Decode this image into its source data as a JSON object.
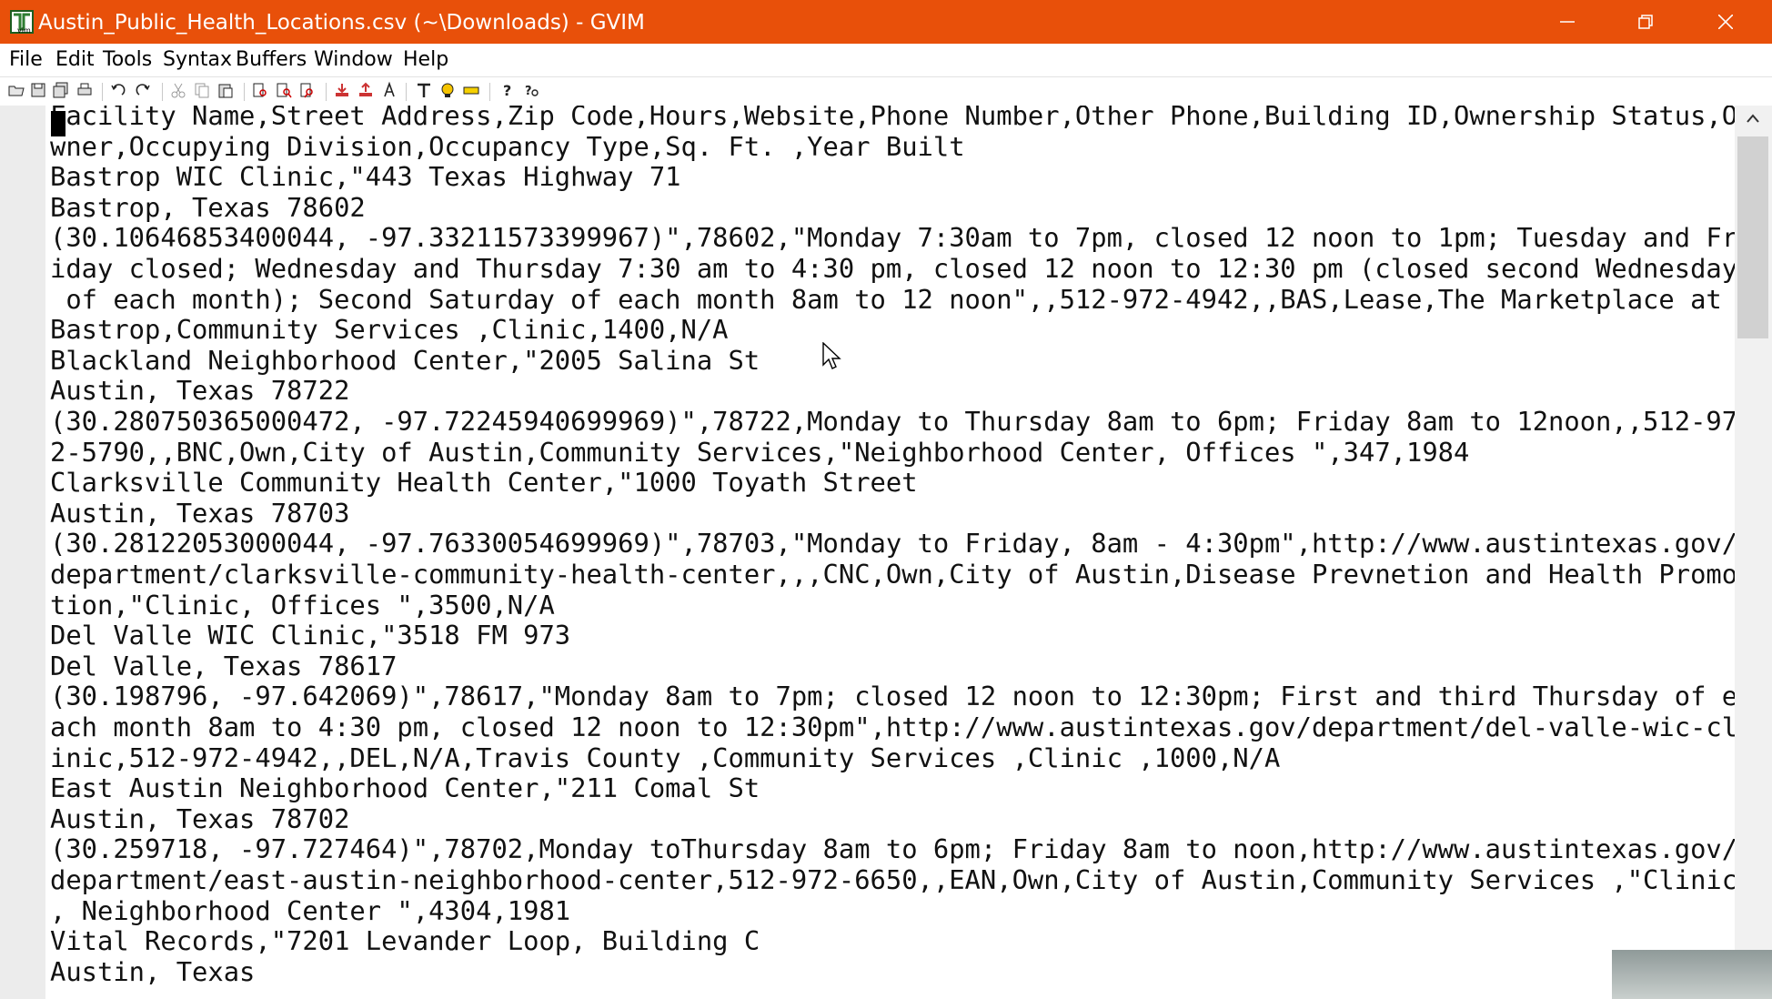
{
  "window": {
    "title": "Austin_Public_Health_Locations.csv (~\\Downloads) - GVIM",
    "titlebar_color": "#e8500a"
  },
  "menu": [
    "File",
    "Edit",
    "Tools",
    "Syntax",
    "Buffers",
    "Window",
    "Help"
  ],
  "toolbar_icons": [
    "open-icon",
    "save-icon",
    "save-all-icon",
    "print-icon",
    "undo-icon",
    "redo-icon",
    "cut-icon",
    "copy-icon",
    "paste-icon",
    "find-replace-icon",
    "find-next-icon",
    "find-prev-icon",
    "load-session-icon",
    "save-session-icon",
    "run-script-icon",
    "make-icon",
    "shell-icon",
    "run-ctags-icon",
    "help-icon",
    "find-help-icon"
  ],
  "editor": {
    "lines": [
      "Facility Name,Street Address,Zip Code,Hours,Website,Phone Number,Other Phone,Building ID,Ownership Status,O",
      "wner,Occupying Division,Occupancy Type,Sq. Ft. ,Year Built",
      "Bastrop WIC Clinic,\"443 Texas Highway 71",
      "Bastrop, Texas 78602",
      "(30.10646853400044, -97.33211573399967)\",78602,\"Monday 7:30am to 7pm, closed 12 noon to 1pm; Tuesday and Fr",
      "iday closed; Wednesday and Thursday 7:30 am to 4:30 pm, closed 12 noon to 12:30 pm (closed second Wednesday",
      " of each month); Second Saturday of each month 8am to 12 noon\",,512-972-4942,,BAS,Lease,The Marketplace at",
      "Bastrop,Community Services ,Clinic,1400,N/A",
      "Blackland Neighborhood Center,\"2005 Salina St",
      "Austin, Texas 78722",
      "(30.280750365000472, -97.72245940699969)\",78722,Monday to Thursday 8am to 6pm; Friday 8am to 12noon,,512-97",
      "2-5790,,BNC,Own,City of Austin,Community Services,\"Neighborhood Center, Offices \",347,1984",
      "Clarksville Community Health Center,\"1000 Toyath Street",
      "Austin, Texas 78703",
      "(30.28122053000044, -97.76330054699969)\",78703,\"Monday to Friday, 8am - 4:30pm\",http://www.austintexas.gov/",
      "department/clarksville-community-health-center,,,CNC,Own,City of Austin,Disease Prevnetion and Health Promo",
      "tion,\"Clinic, Offices \",3500,N/A",
      "Del Valle WIC Clinic,\"3518 FM 973",
      "Del Valle, Texas 78617",
      "(30.198796, -97.642069)\",78617,\"Monday 8am to 7pm; closed 12 noon to 12:30pm; First and third Thursday of e",
      "ach month 8am to 4:30 pm, closed 12 noon to 12:30pm\",http://www.austintexas.gov/department/del-valle-wic-cl",
      "inic,512-972-4942,,DEL,N/A,Travis County ,Community Services ,Clinic ,1000,N/A",
      "East Austin Neighborhood Center,\"211 Comal St",
      "Austin, Texas 78702",
      "(30.259718, -97.727464)\",78702,Monday toThursday 8am to 6pm; Friday 8am to noon,http://www.austintexas.gov/",
      "department/east-austin-neighborhood-center,512-972-6650,,EAN,Own,City of Austin,Community Services ,\"Clinic",
      ", Neighborhood Center \",4304,1981",
      "Vital Records,\"7201 Levander Loop, Building C",
      "Austin, Texas"
    ]
  }
}
